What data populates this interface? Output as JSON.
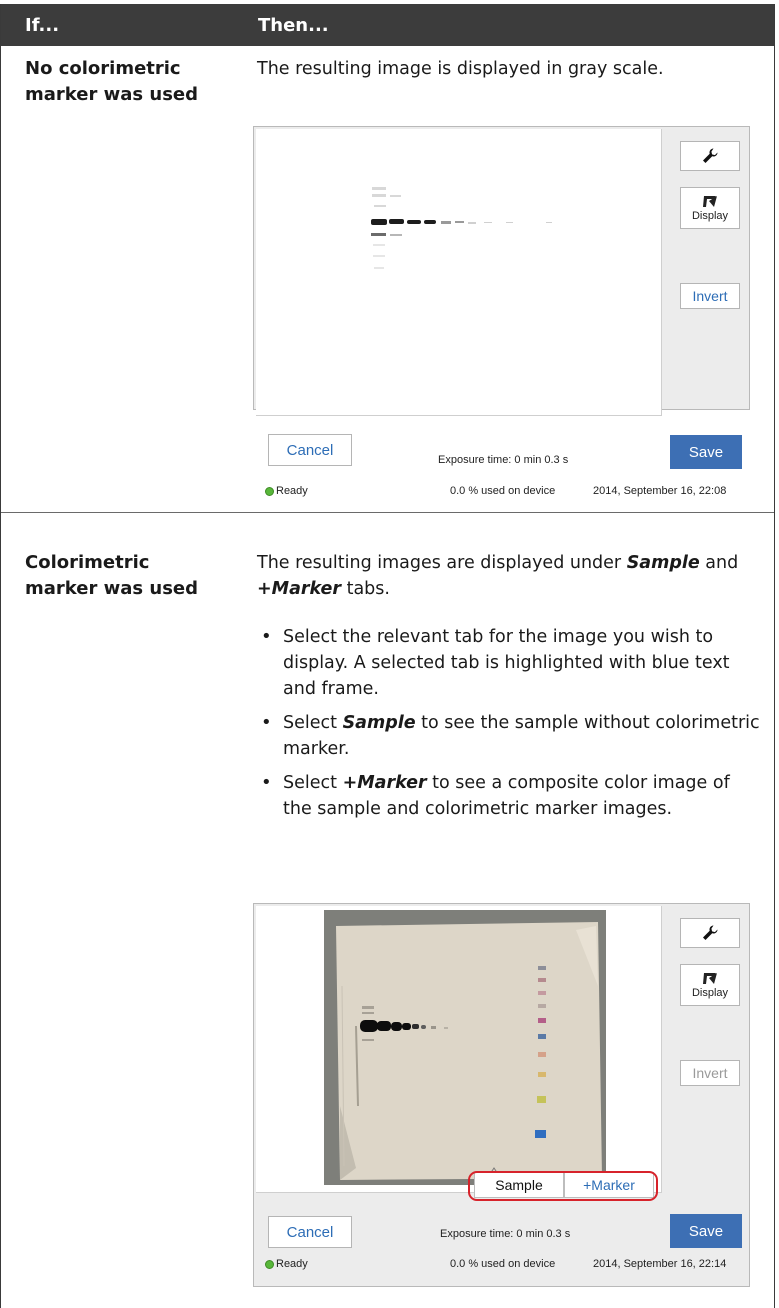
{
  "header": {
    "col_if": "If...",
    "col_then": "Then..."
  },
  "rows": [
    {
      "condition": "No colorimetric marker was used",
      "text": "The resulting image is displayed in gray scale."
    },
    {
      "condition": "Colorimetric marker was used",
      "text_parts": [
        "The resulting images are displayed under ",
        "Sample",
        " and ",
        "+Marker",
        " tabs."
      ],
      "bullets": [
        {
          "plain": "Select the relevant tab for the image you wish to display. A selected tab is highlighted with blue text and frame."
        },
        {
          "pre": "Select ",
          "bold": "Sample",
          "post": " to see the sample without colorimetric marker."
        },
        {
          "pre": "Select ",
          "bold": "+Marker",
          "post": " to see a composite color image of the sample and colorimetric marker images."
        }
      ]
    }
  ],
  "screens": [
    {
      "display_label": "Display",
      "invert_label": "Invert",
      "invert_enabled": true,
      "cancel_label": "Cancel",
      "save_label": "Save",
      "exposure": "Exposure time: 0 min 0.3 s",
      "status": "Ready",
      "usage": "0.0 % used on device",
      "timestamp": "2014, September 16, 22:08",
      "icons": [
        "wrench-icon",
        "display-icon",
        "status-dot-icon"
      ],
      "image_style": "grayscale"
    },
    {
      "display_label": "Display",
      "invert_label": "Invert",
      "invert_enabled": false,
      "cancel_label": "Cancel",
      "save_label": "Save",
      "exposure": "Exposure time: 0 min 0.3 s",
      "status": "Ready",
      "usage": "0.0 % used on device",
      "timestamp": "2014, September 16, 22:14",
      "tabs": [
        "Sample",
        "+Marker"
      ],
      "selected_tab": "+Marker",
      "icons": [
        "wrench-icon",
        "display-icon",
        "status-dot-icon"
      ],
      "image_style": "color composite",
      "colors": {
        "save": "#3d6fb4",
        "link": "#2d6db6",
        "highlight": "#d7232b",
        "status": "#58b73a"
      }
    }
  ]
}
